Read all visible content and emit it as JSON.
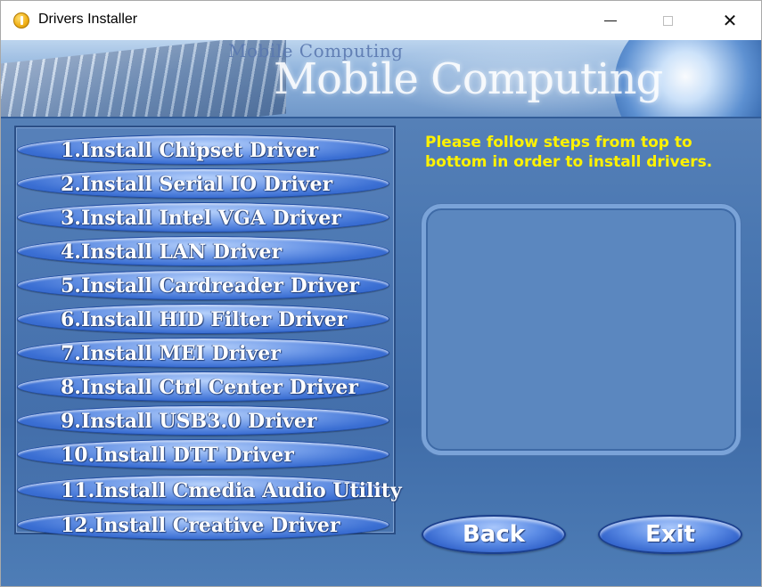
{
  "window": {
    "title": "Drivers Installer",
    "controls": {
      "minimize": "—",
      "maximize": "☐",
      "close": "✕"
    }
  },
  "banner": {
    "small_text": "Mobile Computing",
    "big_text": "Mobile Computing"
  },
  "driver_buttons": [
    {
      "label": "1.Install Chipset Driver"
    },
    {
      "label": "2.Install Serial IO Driver"
    },
    {
      "label": "3.Install Intel VGA Driver"
    },
    {
      "label": "4.Install LAN Driver"
    },
    {
      "label": "5.Install Cardreader Driver"
    },
    {
      "label": "6.Install HID Filter Driver"
    },
    {
      "label": "7.Install MEI Driver"
    },
    {
      "label": "8.Install Ctrl Center Driver"
    },
    {
      "label": "9.Install USB3.0 Driver"
    },
    {
      "label": "10.Install DTT Driver"
    },
    {
      "label": "11.Install Cmedia Audio Utility"
    },
    {
      "label": "12.Install Creative Driver"
    }
  ],
  "instructions": "Please follow steps from top to bottom in order to install drivers.",
  "info_box": {
    "text": ""
  },
  "actions": {
    "back_label": "Back",
    "exit_label": "Exit"
  },
  "colors": {
    "instruction_text": "#fff200",
    "background": "#4b78b2",
    "button_blue": "#3b6fd3"
  },
  "icons": {
    "app": "app-disc-icon"
  }
}
